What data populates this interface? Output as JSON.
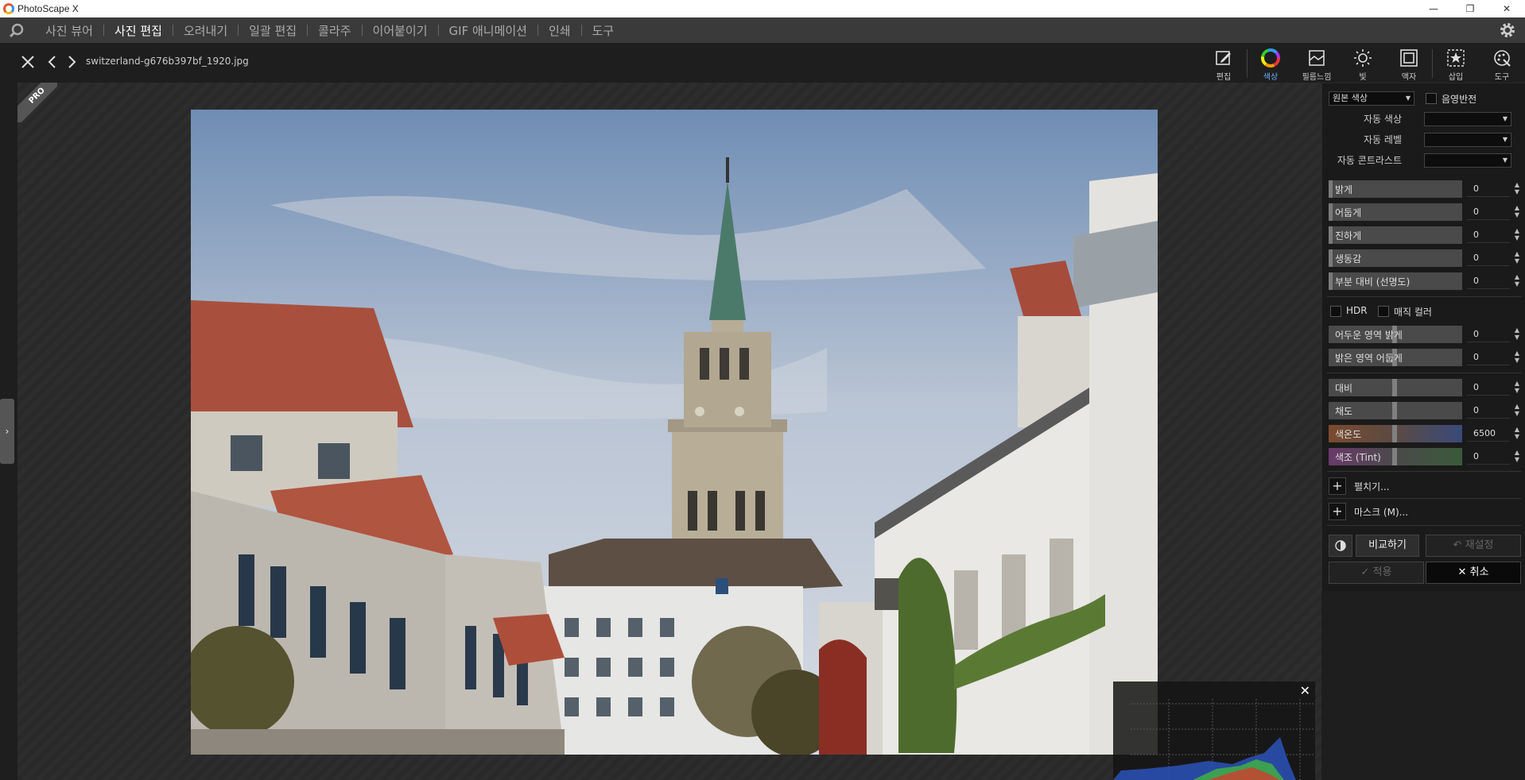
{
  "window": {
    "title": "PhotoScape X",
    "minimize": "—",
    "maximize": "❐",
    "close": "✕"
  },
  "menu": {
    "items": [
      {
        "label": "사진 뷰어",
        "active": false
      },
      {
        "label": "사진 편집",
        "active": true
      },
      {
        "label": "오려내기",
        "active": false
      },
      {
        "label": "일괄 편집",
        "active": false
      },
      {
        "label": "콜라주",
        "active": false
      },
      {
        "label": "이어붙이기",
        "active": false
      },
      {
        "label": "GIF 애니메이션",
        "active": false
      },
      {
        "label": "인쇄",
        "active": false
      },
      {
        "label": "도구",
        "active": false
      }
    ]
  },
  "toolbar": {
    "filename": "switzerland-g676b397bf_1920.jpg",
    "tools": [
      {
        "label": "편집",
        "icon": "edit-icon"
      },
      {
        "label": "색상",
        "icon": "color-wheel-icon",
        "active": true
      },
      {
        "label": "필름느낌",
        "icon": "film-icon"
      },
      {
        "label": "빛",
        "icon": "light-icon"
      },
      {
        "label": "액자",
        "icon": "frame-icon"
      },
      {
        "label": "삽입",
        "icon": "insert-icon"
      },
      {
        "label": "도구",
        "icon": "tools-icon"
      }
    ]
  },
  "canvas": {
    "badge": "PRO",
    "histogram_close": "✕"
  },
  "panel": {
    "color_mode": "원본 색상",
    "invert_label": "음영반전",
    "auto_color": "자동 색상",
    "auto_level": "자동 레벨",
    "auto_contrast": "자동 콘트라스트",
    "sliders_top": [
      {
        "label": "밝게",
        "value": "0"
      },
      {
        "label": "어둡게",
        "value": "0"
      },
      {
        "label": "진하게",
        "value": "0"
      },
      {
        "label": "생동감",
        "value": "0"
      },
      {
        "label": "부분 대비 (선명도)",
        "value": "0"
      }
    ],
    "hdr_label": "HDR",
    "magic_color_label": "매직 컬러",
    "sliders_mid": [
      {
        "label": "어두운 영역 밝게",
        "value": "0"
      },
      {
        "label": "밝은 영역 어둡게",
        "value": "0"
      }
    ],
    "sliders_bottom": [
      {
        "label": "대비",
        "value": "0"
      },
      {
        "label": "채도",
        "value": "0"
      },
      {
        "label": "색온도",
        "value": "6500"
      },
      {
        "label": "색조 (Tint)",
        "value": "0"
      }
    ],
    "expand_label": "펼치기...",
    "mask_label": "마스크 (M)...",
    "compare_label": "비교하기",
    "reset_label": "재설정",
    "apply_label": "적용",
    "cancel_label": "취소"
  }
}
